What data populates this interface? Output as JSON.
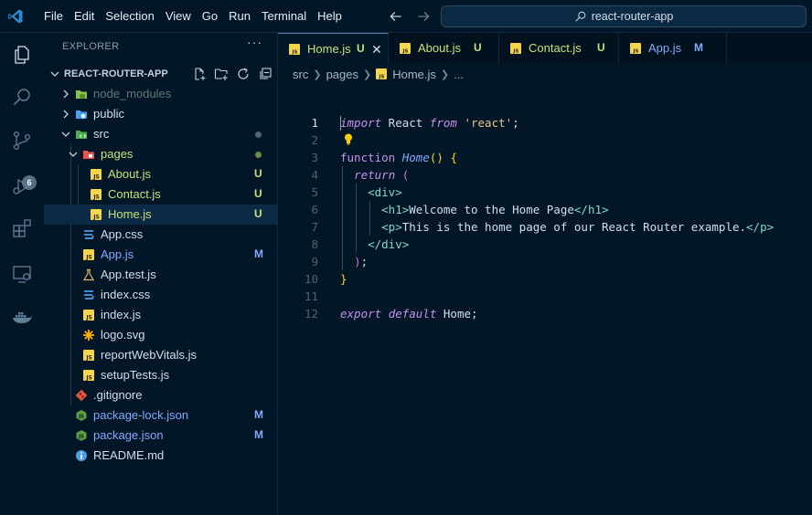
{
  "titlebar": {
    "menu": [
      "File",
      "Edit",
      "Selection",
      "View",
      "Go",
      "Run",
      "Terminal",
      "Help"
    ],
    "search_text": "react-router-app"
  },
  "activity": {
    "scm_badge": "6"
  },
  "sidebar": {
    "header": "EXPLORER",
    "more": "···",
    "root_label": "REACT-ROUTER-APP",
    "tree": [
      {
        "label": "node_modules",
        "depth": 1,
        "kind": "folder-closed",
        "icon": "node-folder-icon",
        "color": "#637777",
        "status": ""
      },
      {
        "label": "public",
        "depth": 1,
        "kind": "folder-closed",
        "icon": "globe-folder-icon",
        "color": "#d6deeb",
        "status": ""
      },
      {
        "label": "src",
        "depth": 1,
        "kind": "folder-open",
        "icon": "src-folder-icon",
        "color": "#d6deeb",
        "status": "dot-grey"
      },
      {
        "label": "pages",
        "depth": 2,
        "kind": "folder-open",
        "icon": "pages-folder-icon",
        "color": "#c5e478",
        "status": "dot-green"
      },
      {
        "label": "About.js",
        "depth": 3,
        "kind": "file",
        "icon": "js-file-icon",
        "color": "#c5e478",
        "status": "U"
      },
      {
        "label": "Contact.js",
        "depth": 3,
        "kind": "file",
        "icon": "js-file-icon",
        "color": "#c5e478",
        "status": "U"
      },
      {
        "label": "Home.js",
        "depth": 3,
        "kind": "file",
        "icon": "js-file-icon",
        "color": "#c5e478",
        "status": "U",
        "selected": true
      },
      {
        "label": "App.css",
        "depth": 2,
        "kind": "file",
        "icon": "css-file-icon",
        "color": "#d6deeb",
        "status": ""
      },
      {
        "label": "App.js",
        "depth": 2,
        "kind": "file",
        "icon": "js-file-icon",
        "color": "#82aaff",
        "status": "M"
      },
      {
        "label": "App.test.js",
        "depth": 2,
        "kind": "file",
        "icon": "test-file-icon",
        "color": "#d6deeb",
        "status": ""
      },
      {
        "label": "index.css",
        "depth": 2,
        "kind": "file",
        "icon": "css-file-icon",
        "color": "#d6deeb",
        "status": ""
      },
      {
        "label": "index.js",
        "depth": 2,
        "kind": "file",
        "icon": "js-file-icon",
        "color": "#d6deeb",
        "status": ""
      },
      {
        "label": "logo.svg",
        "depth": 2,
        "kind": "file",
        "icon": "svg-file-icon",
        "color": "#d6deeb",
        "status": ""
      },
      {
        "label": "reportWebVitals.js",
        "depth": 2,
        "kind": "file",
        "icon": "js-file-icon",
        "color": "#d6deeb",
        "status": ""
      },
      {
        "label": "setupTests.js",
        "depth": 2,
        "kind": "file",
        "icon": "js-file-icon",
        "color": "#d6deeb",
        "status": ""
      },
      {
        "label": ".gitignore",
        "depth": 1,
        "kind": "file",
        "icon": "git-file-icon",
        "color": "#d6deeb",
        "status": ""
      },
      {
        "label": "package-lock.json",
        "depth": 1,
        "kind": "file",
        "icon": "node-json-icon",
        "color": "#82aaff",
        "status": "M"
      },
      {
        "label": "package.json",
        "depth": 1,
        "kind": "file",
        "icon": "node-json-icon",
        "color": "#82aaff",
        "status": "M"
      },
      {
        "label": "README.md",
        "depth": 1,
        "kind": "file",
        "icon": "info-file-icon",
        "color": "#d6deeb",
        "status": ""
      }
    ]
  },
  "tabs": [
    {
      "label": "Home.js",
      "status": "U",
      "status_color": "#c5e478",
      "label_color": "#c5e478",
      "active": true,
      "close": "✕"
    },
    {
      "label": "About.js",
      "status": "U",
      "status_color": "#c5e478",
      "label_color": "#c5e478",
      "active": false
    },
    {
      "label": "Contact.js",
      "status": "U",
      "status_color": "#c5e478",
      "label_color": "#c5e478",
      "active": false
    },
    {
      "label": "App.js",
      "status": "M",
      "status_color": "#82aaff",
      "label_color": "#82aaff",
      "active": false
    }
  ],
  "breadcrumb": {
    "parts": [
      "src",
      "pages",
      "Home.js",
      "..."
    ]
  },
  "editor": {
    "line_numbers": [
      "1",
      "2",
      "3",
      "4",
      "5",
      "6",
      "7",
      "8",
      "9",
      "10",
      "11",
      "12"
    ],
    "current_line": 1,
    "lines": [
      [
        {
          "t": "import",
          "c": "kw-i"
        },
        {
          "t": " React ",
          "c": "plain"
        },
        {
          "t": "from",
          "c": "kw-i"
        },
        {
          "t": " 'react'",
          "c": "str"
        },
        {
          "t": ";",
          "c": "plain"
        }
      ],
      [],
      [
        {
          "t": "function",
          "c": "kw"
        },
        {
          "t": " ",
          "c": "plain"
        },
        {
          "t": "Home",
          "c": "fn"
        },
        {
          "t": "()",
          "c": "br"
        },
        {
          "t": " ",
          "c": "plain"
        },
        {
          "t": "{",
          "c": "br"
        }
      ],
      [
        {
          "t": "  ",
          "c": "plain"
        },
        {
          "t": "return",
          "c": "kw-i"
        },
        {
          "t": " ",
          "c": "plain"
        },
        {
          "t": "(",
          "c": "br2"
        }
      ],
      [
        {
          "t": "    <div>",
          "c": "plain"
        }
      ],
      [
        {
          "t": "      <h1>",
          "c": "plain"
        },
        {
          "t": "Welcome to the Home Page",
          "c": "plain"
        },
        {
          "t": "</h1>",
          "c": "plain"
        }
      ],
      [
        {
          "t": "      <p>",
          "c": "plain"
        },
        {
          "t": "This is the home page of our React Router example.",
          "c": "plain"
        },
        {
          "t": "</p>",
          "c": "plain"
        }
      ],
      [
        {
          "t": "    </div>",
          "c": "plain"
        }
      ],
      [
        {
          "t": "  ",
          "c": "plain"
        },
        {
          "t": ")",
          "c": "br2"
        },
        {
          "t": ";",
          "c": "plain"
        }
      ],
      [
        {
          "t": "}",
          "c": "br"
        }
      ],
      [],
      [
        {
          "t": "export",
          "c": "kw-i"
        },
        {
          "t": " ",
          "c": "plain"
        },
        {
          "t": "default",
          "c": "kw-i"
        },
        {
          "t": " Home;",
          "c": "plain"
        }
      ]
    ]
  },
  "colors": {
    "background": "#011627",
    "untracked": "#c5e478",
    "modified": "#82aaff",
    "accent": "#007acc"
  }
}
